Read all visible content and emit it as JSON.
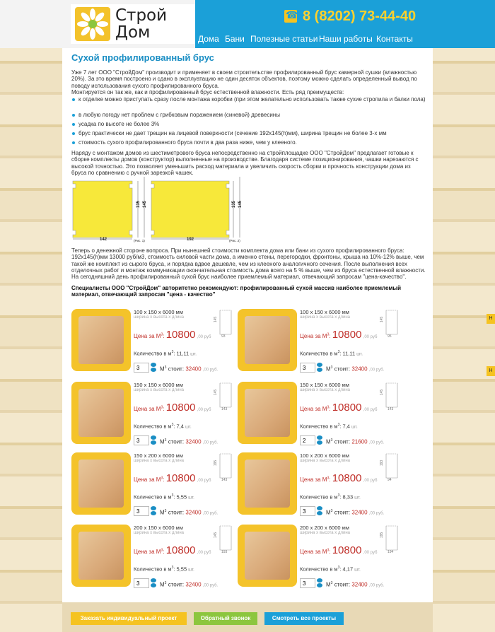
{
  "header": {
    "logo_line1": "Строй",
    "logo_line2": "Дом",
    "phone": "8 (8202) 73-44-40",
    "nav": [
      "Дома",
      "Бани",
      "Полезные статьи",
      "Наши работы",
      "Контакты"
    ]
  },
  "article": {
    "title": "Сухой профилированный брус",
    "p1": "Уже 7 лет ООО \"СтройДом\" производит и применяет в своем строительстве профилированный брус камерной сушки (влажностью 20%). За это время построено и сдано в эксплуатацию не один десяток объектов, поэтому можно сделать определенный вывод по поводу использования сухого профилированного бруса.",
    "p2": "Монтируется он так же, как и профилированный брус естественной влажности. Есть ряд преимуществ:",
    "bullets": [
      "к отделке можно приступать сразу после монтажа коробки (при этом желательно использовать также сухие стропила и балки пола)",
      "в любую погоду нет проблем с грибковым поражением (синевой) древесины",
      "усадка по высоте не более 3%",
      "брус практически не дает трещин на лицевой поверхности (сечение 192х145(h)мм), ширина трещин не более 3-х мм",
      "стоимость сухого профилированного бруса почти в два раза ниже, чем у клееного."
    ],
    "p3": "Наряду с монтажом домов из шестиметрового бруса непосредственно на стройплощадке ООО \"СтройДом\" предлагает готовые к сборке комплекты домов (конструктор) выполненные на производстве. Благодаря системе позиционирования, чашки нарезаются с высокой точностью. Это позволяет уменьшить расход материала и увеличить скорость сборки и прочность конструкции дома из бруса по сравнению с ручной зарезкой чашек.",
    "p4": "Теперь о денежной стороне вопроса. При нынешней стоимости комплекта дома или бани из сухого профилированного бруса: 192х145(h)мм 13000 руб/м3, стоимость силовой части дома, а именно стены, перегородки, фронтоны, крыша на 10%-12% выше, чем такой же комплект из сырого бруса, и порядка вдвое дешевле, чем из клееного аналогичного сечения. После выполнения всех отделочных работ и монтаж коммуникации окончательная стоимость дома всего на 5 % выше, чем из бруса естественной влажности. На сегодняшний день профилированный сухой брус наиболее приемлемый материал, отвечающий запросам \"цена-качество\".",
    "p5": "Специалисты ООО \"СтройДом\" авторитетно рекомендуют: профилированный сухой массив наиболее приемлемый материал, отвечающий запросам \"цена - качество\""
  },
  "diagrams": [
    {
      "w": "142",
      "h1": "135",
      "h2": "145",
      "cap": "(Рис. 1)"
    },
    {
      "w": "192",
      "h1": "135",
      "h2": "145",
      "cap": "(Рис. 2)"
    }
  ],
  "labels": {
    "size_sub": "ширина х высота х длина",
    "price_pre": "Цена за М",
    "price_post": "00 руб",
    "qty_pre": "Количество в м",
    "qty_unit": "шт.",
    "cost_post": "стоит:",
    "rub": ",00 руб."
  },
  "products": [
    {
      "size": "100 x 150 x 6000 мм",
      "price": "10800",
      "qty": "11,11",
      "count": "3",
      "cost": "32400",
      "ph": "145",
      "pw": "93"
    },
    {
      "size": "100 x 150 x 6000 мм",
      "price": "10800",
      "qty": "11,11",
      "count": "3",
      "cost": "32400",
      "ph": "145",
      "pw": "95"
    },
    {
      "size": "150 x 150 x 6000 мм",
      "price": "10800",
      "qty": "7,4",
      "count": "3",
      "cost": "32400",
      "ph": "145",
      "pw": "143"
    },
    {
      "size": "150 x 150 x 6000 мм",
      "price": "10800",
      "qty": "7,4",
      "count": "2",
      "cost": "21600",
      "ph": "145",
      "pw": "143"
    },
    {
      "size": "150 x 200 x 6000 мм",
      "price": "10800",
      "qty": "5,55",
      "count": "3",
      "cost": "32400",
      "ph": "195",
      "pw": "143"
    },
    {
      "size": "100 x 200 x 6000 мм",
      "price": "10800",
      "qty": "8,33",
      "count": "3",
      "cost": "32400",
      "ph": "193",
      "pw": "94"
    },
    {
      "size": "200 x 150 x 6000 мм",
      "price": "10800",
      "qty": "5,55",
      "count": "3",
      "cost": "32400",
      "ph": "145",
      "pw": "193"
    },
    {
      "size": "200 x 200 x 6000 мм",
      "price": "10800",
      "qty": "4,17",
      "count": "3",
      "cost": "32400",
      "ph": "195",
      "pw": "194"
    }
  ],
  "footer_buttons": [
    {
      "label": "Заказать индивидуальный проект",
      "color": "#f5c321"
    },
    {
      "label": "Обратный звонок",
      "color": "#8cc63e"
    },
    {
      "label": "Смотреть все проекты",
      "color": "#1ba0d8"
    }
  ],
  "side_tabs": [
    "Н",
    "Н"
  ]
}
